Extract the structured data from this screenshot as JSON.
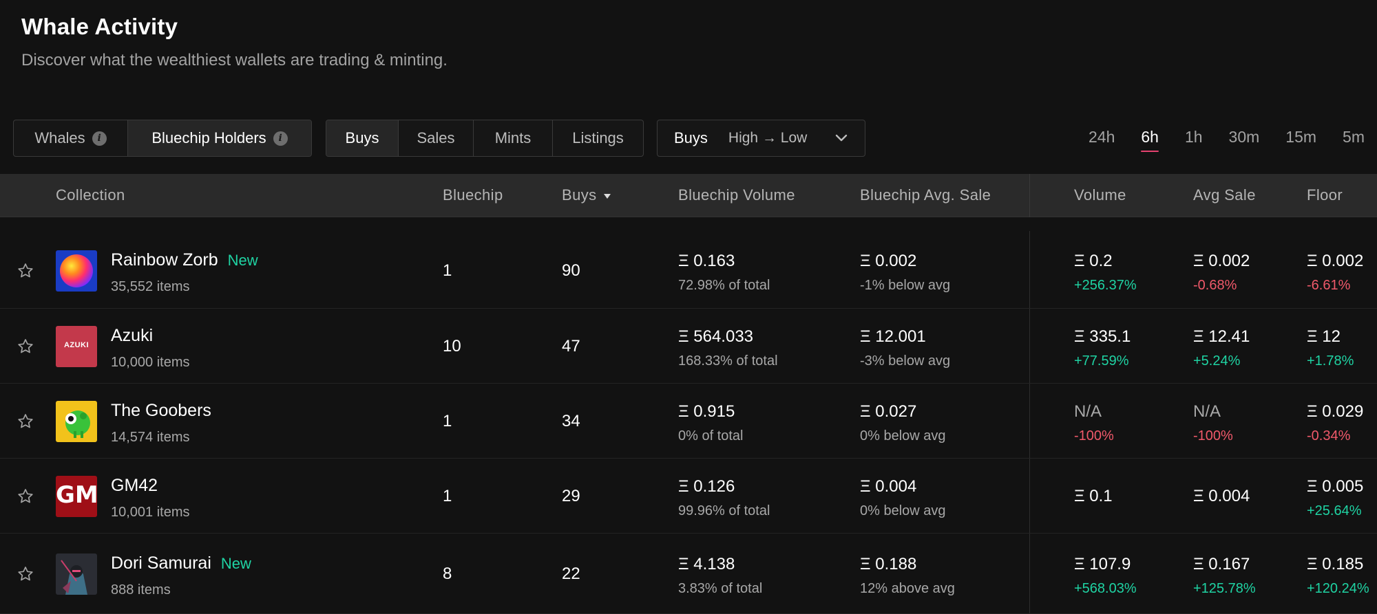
{
  "header": {
    "title": "Whale Activity",
    "subtitle": "Discover what the wealthiest wallets are trading & minting."
  },
  "holder_filter": {
    "options": [
      "Whales",
      "Bluechip Holders"
    ],
    "active": "Bluechip Holders"
  },
  "activity_filter": {
    "options": [
      "Buys",
      "Sales",
      "Mints",
      "Listings"
    ],
    "active": "Buys"
  },
  "sort": {
    "field": "Buys",
    "order": "High → Low"
  },
  "timeframes": {
    "options": [
      "24h",
      "6h",
      "1h",
      "30m",
      "15m",
      "5m"
    ],
    "active": "6h"
  },
  "columns": {
    "collection": "Collection",
    "bluechip": "Bluechip",
    "buys": "Buys",
    "bluechip_volume": "Bluechip Volume",
    "bluechip_avg_sale": "Bluechip Avg. Sale",
    "volume": "Volume",
    "avg_sale": "Avg Sale",
    "floor": "Floor"
  },
  "rows": [
    {
      "name": "Rainbow Zorb",
      "badge": "New",
      "items": "35,552 items",
      "avatar": "rainbow-zorb",
      "bluechip": "1",
      "buys": "90",
      "bc_volume": "Ξ 0.163",
      "bc_volume_sub": "72.98% of total",
      "bc_avg": "Ξ 0.002",
      "bc_avg_sub": "-1% below avg",
      "volume": "Ξ 0.2",
      "volume_change": "+256.37%",
      "volume_trend": "pos",
      "avg_sale": "Ξ 0.002",
      "avg_sale_change": "-0.68%",
      "avg_sale_trend": "neg",
      "floor": "Ξ 0.002",
      "floor_change": "-6.61%",
      "floor_trend": "neg"
    },
    {
      "name": "Azuki",
      "badge": "",
      "items": "10,000 items",
      "avatar": "azuki",
      "avatar_text": "AZUKI",
      "bluechip": "10",
      "buys": "47",
      "bc_volume": "Ξ 564.033",
      "bc_volume_sub": "168.33% of total",
      "bc_avg": "Ξ 12.001",
      "bc_avg_sub": "-3% below avg",
      "volume": "Ξ 335.1",
      "volume_change": "+77.59%",
      "volume_trend": "pos",
      "avg_sale": "Ξ 12.41",
      "avg_sale_change": "+5.24%",
      "avg_sale_trend": "pos",
      "floor": "Ξ 12",
      "floor_change": "+1.78%",
      "floor_trend": "pos"
    },
    {
      "name": "The Goobers",
      "badge": "",
      "items": "14,574 items",
      "avatar": "goobers",
      "bluechip": "1",
      "buys": "34",
      "bc_volume": "Ξ 0.915",
      "bc_volume_sub": "0% of total",
      "bc_avg": "Ξ 0.027",
      "bc_avg_sub": "0% below avg",
      "volume": "N/A",
      "volume_change": "-100%",
      "volume_trend": "neg",
      "avg_sale": "N/A",
      "avg_sale_change": "-100%",
      "avg_sale_trend": "neg",
      "floor": "Ξ 0.029",
      "floor_change": "-0.34%",
      "floor_trend": "neg"
    },
    {
      "name": "GM42",
      "badge": "",
      "items": "10,001 items",
      "avatar": "gm42",
      "avatar_text": "GM",
      "bluechip": "1",
      "buys": "29",
      "bc_volume": "Ξ 0.126",
      "bc_volume_sub": "99.96% of total",
      "bc_avg": "Ξ 0.004",
      "bc_avg_sub": "0% below avg",
      "volume": "Ξ 0.1",
      "volume_change": "",
      "volume_trend": "",
      "avg_sale": "Ξ 0.004",
      "avg_sale_change": "",
      "avg_sale_trend": "",
      "floor": "Ξ 0.005",
      "floor_change": "+25.64%",
      "floor_trend": "pos"
    },
    {
      "name": "Dori Samurai",
      "badge": "New",
      "items": "888 items",
      "avatar": "dori-samurai",
      "bluechip": "8",
      "buys": "22",
      "bc_volume": "Ξ 4.138",
      "bc_volume_sub": "3.83% of total",
      "bc_avg": "Ξ 0.188",
      "bc_avg_sub": "12% above avg",
      "volume": "Ξ 107.9",
      "volume_change": "+568.03%",
      "volume_trend": "pos",
      "avg_sale": "Ξ 0.167",
      "avg_sale_change": "+125.78%",
      "avg_sale_trend": "pos",
      "floor": "Ξ 0.185",
      "floor_change": "+120.24%",
      "floor_trend": "pos"
    }
  ],
  "colors": {
    "positive": "#1fd3a3",
    "negative": "#f0596a",
    "accent": "#e5426f",
    "background": "#121212"
  }
}
